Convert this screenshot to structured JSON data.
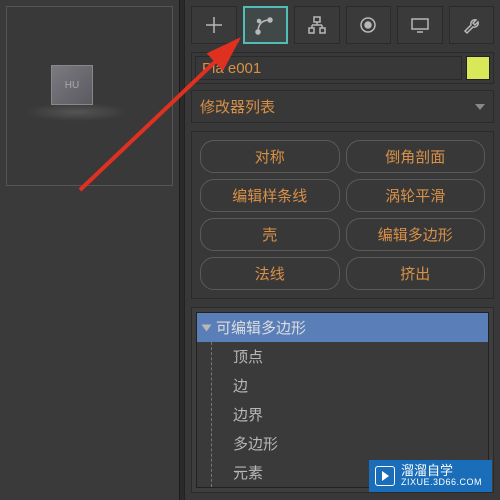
{
  "viewport": {
    "object_label": "HU"
  },
  "tabs": [
    {
      "name": "create",
      "icon": "plus"
    },
    {
      "name": "modify",
      "icon": "bend"
    },
    {
      "name": "hierarchy",
      "icon": "pivot"
    },
    {
      "name": "motion",
      "icon": "circle"
    },
    {
      "name": "display",
      "icon": "monitor"
    },
    {
      "name": "utilities",
      "icon": "wrench"
    }
  ],
  "object": {
    "name": "Pla e001",
    "color": "#d8e858"
  },
  "modifier_list_label": "修改器列表",
  "modifiers": {
    "symmetry": "对称",
    "chamfer": "倒角剖面",
    "editspline": "编辑样条线",
    "turbosmooth": "涡轮平滑",
    "shell": "壳",
    "editpoly": "编辑多边形",
    "normal": "法线",
    "extrude": "挤出"
  },
  "stack": {
    "root": "可编辑多边形",
    "subs": [
      "顶点",
      "边",
      "边界",
      "多边形",
      "元素"
    ]
  },
  "watermark": {
    "title": "溜溜自学",
    "url": "ZIXUE.3D66.COM"
  }
}
